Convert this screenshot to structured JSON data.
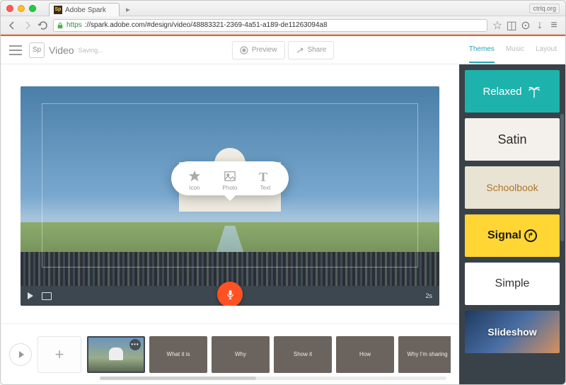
{
  "browser": {
    "tab_title": "Adobe Spark",
    "url_scheme": "https",
    "url_rest": "://spark.adobe.com/#design/video/48883321-2369-4a51-a189-de11263094a8",
    "badge": "ctrlq.org"
  },
  "header": {
    "logo_text": "Sp",
    "app_title": "Video",
    "status": "Saving...",
    "preview": "Preview",
    "share": "Share",
    "tabs": {
      "themes": "Themes",
      "music": "Music",
      "layout": "Layout"
    }
  },
  "picker": {
    "icon": "Icon",
    "photo": "Photo",
    "text": "Text"
  },
  "player": {
    "duration": "2s"
  },
  "timeline": {
    "clips": [
      {
        "kind": "photo",
        "label": ""
      },
      {
        "kind": "text",
        "label": "What it is"
      },
      {
        "kind": "text",
        "label": "Why"
      },
      {
        "kind": "text",
        "label": "Show it"
      },
      {
        "kind": "text",
        "label": "How"
      },
      {
        "kind": "text",
        "label": "Why I'm sharing"
      }
    ]
  },
  "themes": {
    "items": [
      {
        "id": "relaxed",
        "label": "Relaxed"
      },
      {
        "id": "satin",
        "label": "Satin"
      },
      {
        "id": "schoolbook",
        "label": "Schoolbook"
      },
      {
        "id": "signal",
        "label": "Signal"
      },
      {
        "id": "simple",
        "label": "Simple"
      },
      {
        "id": "slideshow",
        "label": "Slideshow"
      }
    ]
  }
}
